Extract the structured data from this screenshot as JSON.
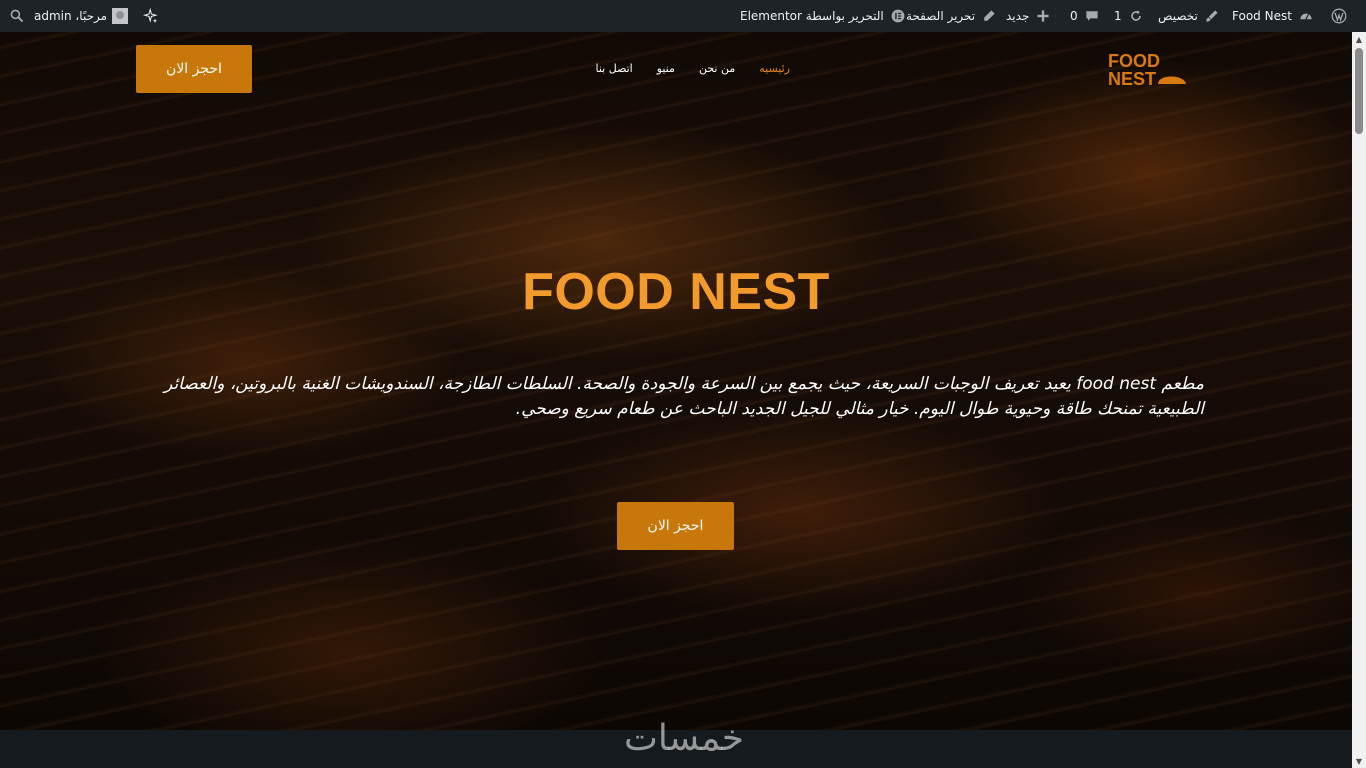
{
  "admin_bar": {
    "wp_logo_icon": "wordpress-icon",
    "site_name": "Food Nest",
    "customize": "تخصيص",
    "updates_count": "1",
    "comments_count": "0",
    "new": "جديد",
    "edit_page": "تحرير الصفحة",
    "elementor_edit": "التحرير بواسطة Elementor",
    "greeting": "مرحبًا، admin"
  },
  "header": {
    "logo_line1": "FOOD",
    "logo_line2": "NEST",
    "nav": [
      "رئيسيه",
      "من نحن",
      "منيو",
      "اتصل بنا"
    ],
    "book_button": "احجز الان"
  },
  "hero": {
    "title": "FOOD NEST",
    "description": "مطعم food nest يعيد تعريف الوجبات السريعة، حيث يجمع بين السرعة والجودة والصحة. السلطات الطازجة، السندويشات الغنية بالبروتين، والعصائر الطبيعية تمنحك طاقة وحيوية طوال اليوم. خيار مثالي للجيل الجديد الباحث عن طعام سريع وصحي.",
    "cta_button": "احجز الان"
  },
  "watermark": "خمسات",
  "colors": {
    "accent": "#c8770a",
    "title": "#f39a2c",
    "nav_active": "#e8891f",
    "admin_bar": "#1d2327"
  }
}
